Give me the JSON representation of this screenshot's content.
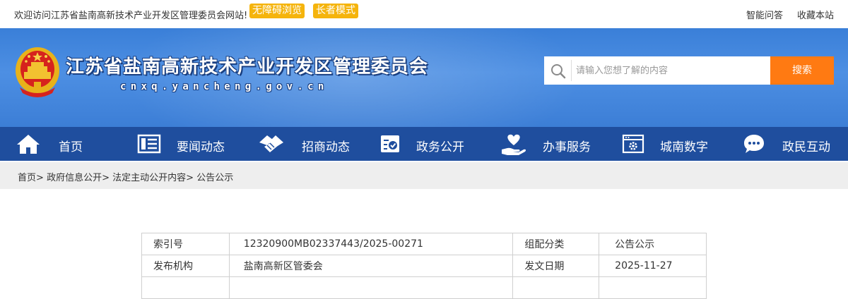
{
  "topbar": {
    "welcome": "欢迎访问江苏省盐南高新技术产业开发区管理委员会网站!",
    "accessibility_badge": "无障碍浏览",
    "elder_mode_badge": "长者模式",
    "links": [
      "智能问答",
      "收藏本站"
    ],
    "badge_color": "#f5b40c"
  },
  "header": {
    "title": "江苏省盐南高新技术产业开发区管理委员会",
    "domain": "cnxq.yancheng.gov.cn",
    "emblem_icon": "national-emblem-icon",
    "banner_color": "#4a8ce0"
  },
  "search": {
    "placeholder": "请输入您想了解的内容",
    "button_label": "搜索",
    "icon": "search-icon",
    "button_color": "#ff7a12"
  },
  "nav": {
    "background": "#1f4e9e",
    "items": [
      {
        "label": "首页",
        "icon": "home-icon"
      },
      {
        "label": "要闻动态",
        "icon": "news-icon"
      },
      {
        "label": "招商动态",
        "icon": "handshake-icon"
      },
      {
        "label": "政务公开",
        "icon": "document-check-icon"
      },
      {
        "label": "办事服务",
        "icon": "heart-hand-icon"
      },
      {
        "label": "城南数字",
        "icon": "digital-gear-icon"
      },
      {
        "label": "政民互动",
        "icon": "chat-icon"
      }
    ]
  },
  "breadcrumb": [
    "首页",
    "政府信息公开",
    "法定主动公开内容",
    "公告公示"
  ],
  "breadcrumb_separator": ">",
  "meta": {
    "rows": [
      {
        "key1": "索引号",
        "val1": "12320900MB02337443/2025-00271",
        "key2": "组配分类",
        "val2": "公告公示"
      },
      {
        "key1": "发布机构",
        "val1": "盐南高新区管委会",
        "key2": "发文日期",
        "val2": "2025-11-27"
      }
    ]
  }
}
